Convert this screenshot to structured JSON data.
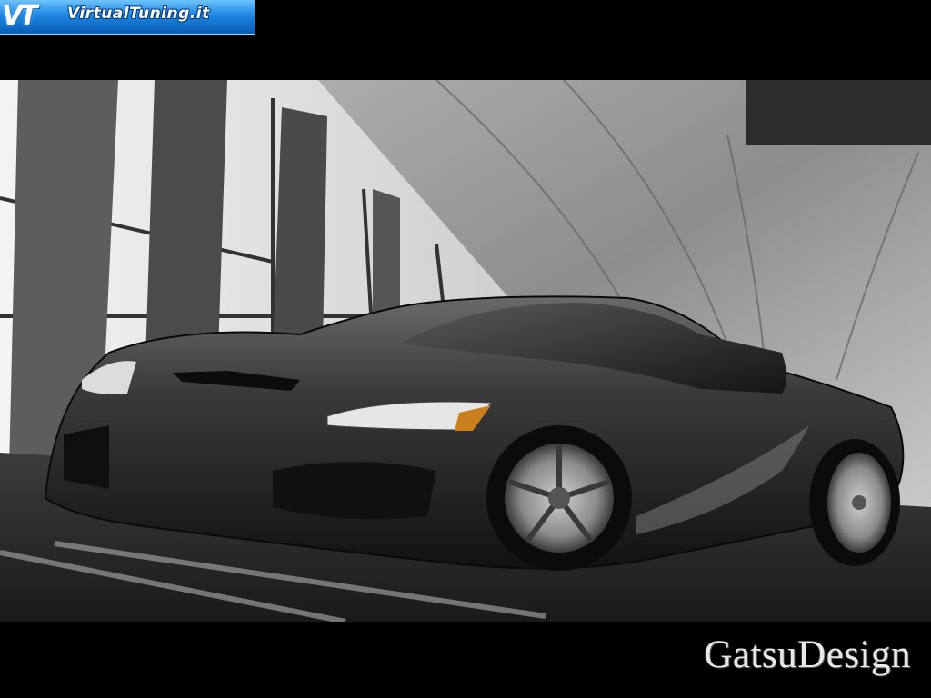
{
  "header": {
    "logo_mark": "VT",
    "logo_text": "VirtualTuning.it",
    "logo_colors": {
      "top": "#6ec3ff",
      "bottom": "#0a5db5"
    }
  },
  "scene": {
    "icon": "sports-car-photo",
    "palette": [
      "#000000",
      "#2a2a2a",
      "#8a8a8a",
      "#d8d8d8",
      "#ffffff"
    ]
  },
  "footer": {
    "signature": "GatsuDesign"
  }
}
